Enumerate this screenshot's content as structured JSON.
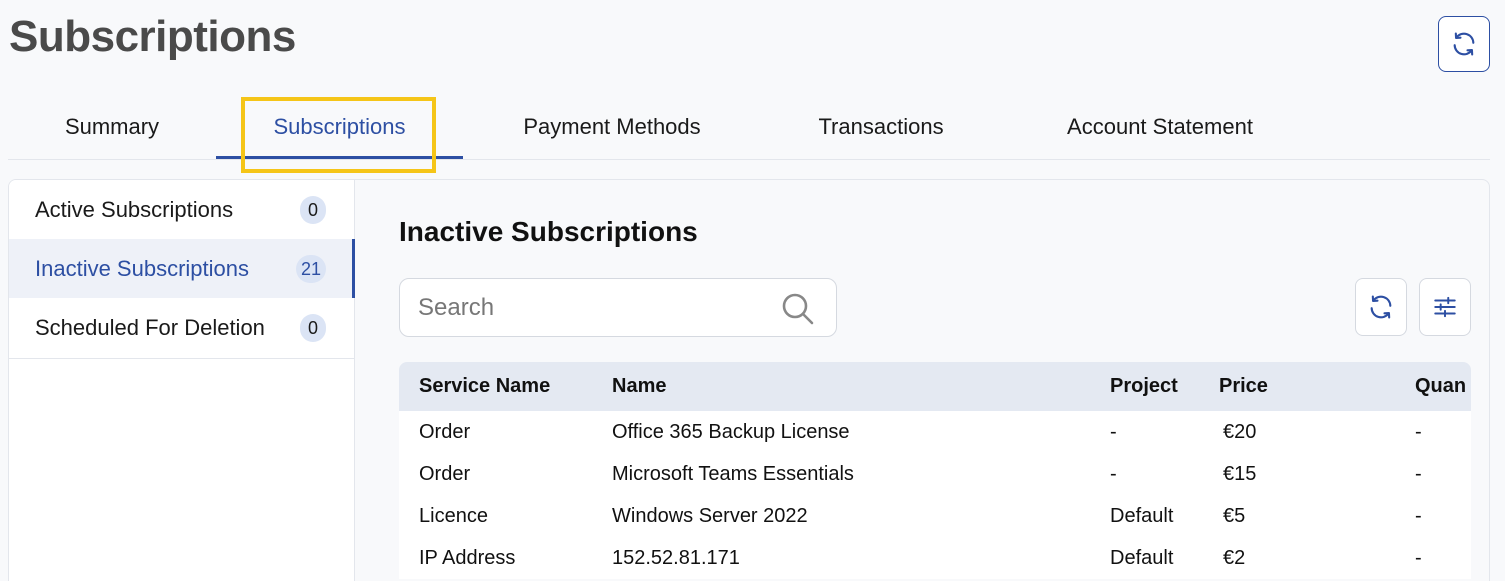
{
  "page": {
    "title": "Subscriptions"
  },
  "tabs": [
    {
      "label": "Summary",
      "active": false
    },
    {
      "label": "Subscriptions",
      "active": true
    },
    {
      "label": "Payment Methods",
      "active": false
    },
    {
      "label": "Transactions",
      "active": false
    },
    {
      "label": "Account Statement",
      "active": false
    }
  ],
  "sidebar": {
    "items": [
      {
        "label": "Active Subscriptions",
        "count": "0",
        "active": false
      },
      {
        "label": "Inactive Subscriptions",
        "count": "21",
        "active": true
      },
      {
        "label": "Scheduled For Deletion",
        "count": "0",
        "active": false
      }
    ]
  },
  "content": {
    "title": "Inactive Subscriptions",
    "search": {
      "placeholder": "Search",
      "value": ""
    }
  },
  "table": {
    "headers": [
      "Service Name",
      "Name",
      "Project",
      "Price",
      "Quan"
    ],
    "rows": [
      [
        "Order",
        "Office 365 Backup License",
        "-",
        "€20",
        "-"
      ],
      [
        "Order",
        "Microsoft Teams Essentials",
        "-",
        "€15",
        "-"
      ],
      [
        "Licence",
        "Windows Server 2022",
        "Default",
        "€5",
        "-"
      ],
      [
        "IP Address",
        "152.52.81.171",
        "Default",
        "€2",
        "-"
      ]
    ]
  },
  "icons": {
    "top_refresh": "refresh-icon",
    "search": "search-icon",
    "table_refresh": "refresh-icon",
    "filter": "sliders-icon"
  },
  "colors": {
    "accent": "#2d4fa3",
    "highlight": "#f5c518",
    "badge_bg": "#dbe4f5",
    "table_header_bg": "#e4e9f2"
  }
}
